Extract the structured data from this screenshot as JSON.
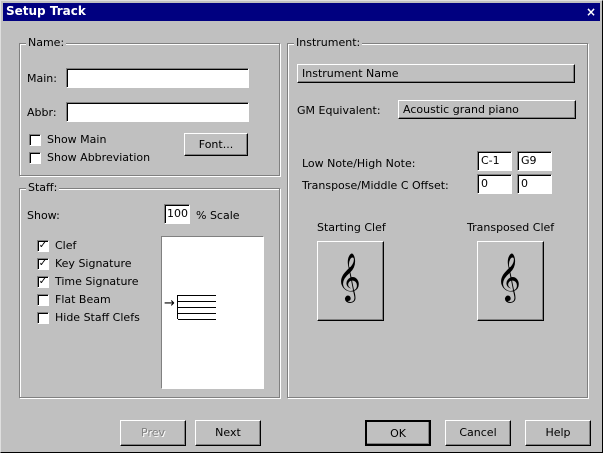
{
  "window": {
    "title": "Setup Track",
    "close_glyph": "×"
  },
  "name_group": {
    "legend": "Name:",
    "main_label": "Main:",
    "main_value": "",
    "abbr_label": "Abbr:",
    "abbr_value": "",
    "show_main": {
      "label": "Show Main",
      "checked": false
    },
    "show_abbreviation": {
      "label": "Show Abbreviation",
      "checked": false
    },
    "font_button": "Font..."
  },
  "staff_group": {
    "legend": "Staff:",
    "show_label": "Show:",
    "scale_value": "100",
    "scale_label": "% Scale",
    "options": [
      {
        "label": "Clef",
        "checked": true
      },
      {
        "label": "Key Signature",
        "checked": true
      },
      {
        "label": "Time Signature",
        "checked": true
      },
      {
        "label": "Flat Beam",
        "checked": false
      },
      {
        "label": "Hide Staff Clefs",
        "checked": false
      }
    ],
    "preview_arrow": "→"
  },
  "instrument_group": {
    "legend": "Instrument:",
    "instrument_name": "Instrument Name",
    "gm_label": "GM Equivalent:",
    "gm_value": "Acoustic grand piano",
    "range_label": "Low Note/High Note:",
    "low_note": "C-1",
    "high_note": "G9",
    "transpose_label": "Transpose/Middle C Offset:",
    "transpose_value": "0",
    "middle_c_offset": "0",
    "starting_clef_label": "Starting Clef",
    "transposed_clef_label": "Transposed Clef",
    "clef_glyph": "𝄞"
  },
  "footer": {
    "prev": "Prev",
    "next": "Next",
    "ok": "OK",
    "cancel": "Cancel",
    "help": "Help"
  },
  "colors": {
    "titlebar": "#000080",
    "face": "#c0c0c0"
  }
}
